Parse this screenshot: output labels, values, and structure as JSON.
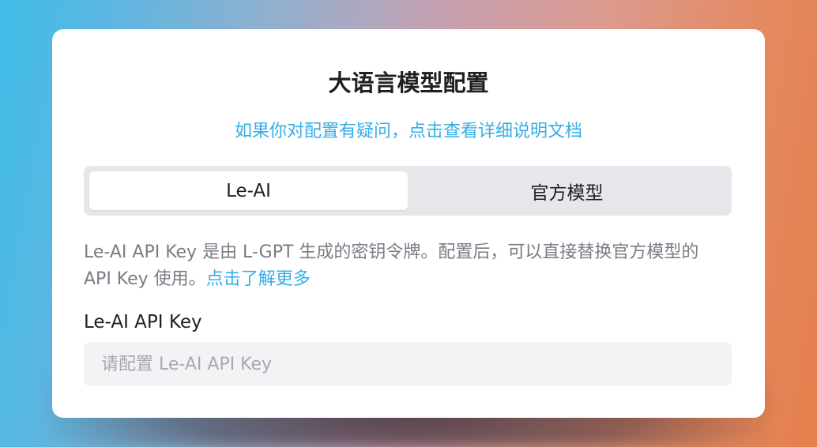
{
  "dialog": {
    "title": "大语言模型配置",
    "help_link": "如果你对配置有疑问，点击查看详细说明文档"
  },
  "tabs": [
    {
      "label": "Le-AI",
      "active": true
    },
    {
      "label": "官方模型",
      "active": false
    }
  ],
  "description": {
    "text": "Le-AI API Key 是由 L-GPT 生成的密钥令牌。配置后，可以直接替换官方模型的 API Key 使用。",
    "more_link": "点击了解更多"
  },
  "api_key_field": {
    "label": "Le-AI API Key",
    "value": "",
    "placeholder": "请配置 Le-AI API Key"
  },
  "colors": {
    "accent": "#35aee6",
    "tab_background": "#e6e7eb",
    "input_background": "#f2f3f5"
  }
}
